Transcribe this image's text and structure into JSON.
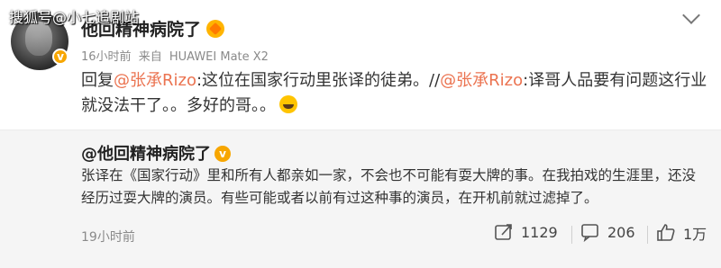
{
  "watermark": "搜狐号@小七追剧站",
  "post": {
    "author": "他回精神病院了",
    "time": "16小时前",
    "source_prefix": "来自",
    "device": "HUAWEI Mate X2",
    "reply_prefix": "回复",
    "mention1": "@张承Rizo",
    "text1": ":这位在国家行动里张译的徒弟。//",
    "mention2": "@张承Rizo",
    "text2": ":译哥人品要有问题这行业就没法干了。。多好的哥。。"
  },
  "quoted": {
    "author": "@他回精神病院了",
    "text": "张译在《国家行动》里和所有人都亲如一家，不会也不可能有耍大牌的事。在我拍戏的生涯里，还没经历过耍大牌的演员。有些可能或者以前有过这种事的演员，在开机前就过滤掉了。",
    "time": "19小时前",
    "reposts": "1129",
    "comments": "206",
    "likes": "1万"
  },
  "colors": {
    "mention": "#eb7350",
    "verified": "#f7a600",
    "quote_bg": "#f5f5f5"
  }
}
